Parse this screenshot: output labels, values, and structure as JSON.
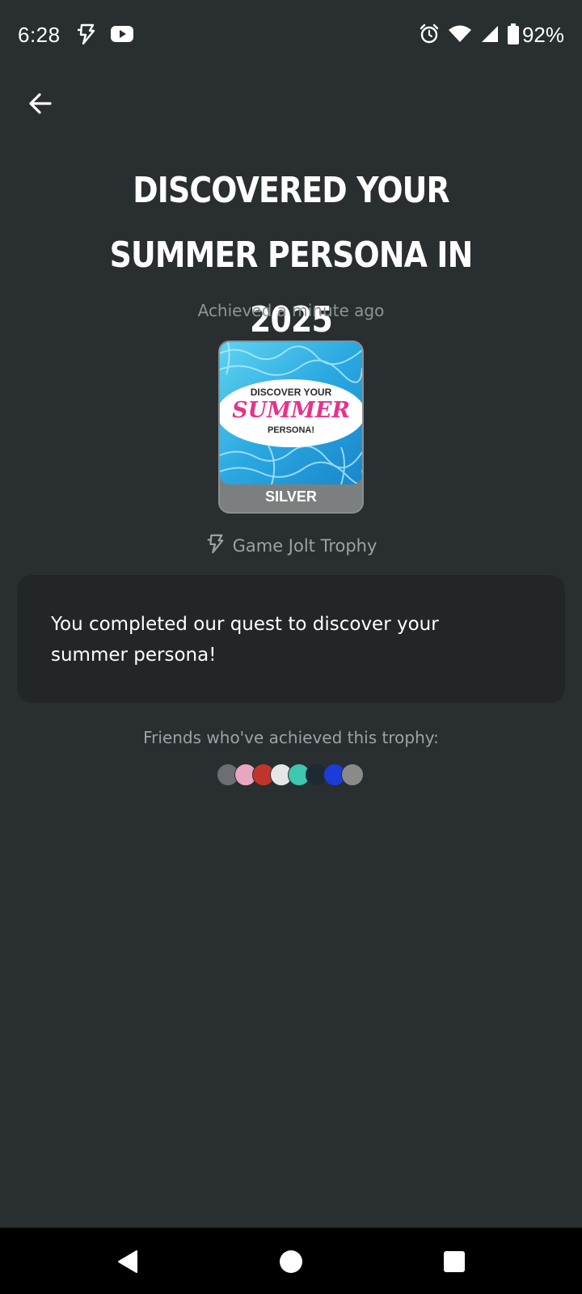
{
  "status_bar": {
    "time": "6:28",
    "battery_percent": "92%",
    "left_icons": [
      "game-jolt-icon",
      "youtube-icon"
    ],
    "right_icons": [
      "alarm-icon",
      "wifi-icon",
      "cell-signal-icon",
      "battery-icon"
    ]
  },
  "header": {
    "back_icon": "arrow-left-icon"
  },
  "trophy": {
    "title": "DISCOVERED YOUR SUMMER PERSONA IN 2025",
    "achieved": "Achieved a minute ago",
    "image_text": {
      "line1": "DISCOVER YOUR",
      "line2": "SUMMER",
      "line3": "PERSONA!"
    },
    "tier": "SILVER",
    "source": "Game Jolt Trophy",
    "description": "You completed our quest to discover your summer persona!"
  },
  "friends": {
    "label": "Friends who've achieved this trophy:",
    "avatar_colors": [
      "#6b6f73",
      "#e9a6c0",
      "#c0352b",
      "#e6e6e6",
      "#3dc7b0",
      "#1c2a34",
      "#1a3cd8",
      "#8a8a8a"
    ]
  },
  "colors": {
    "background": "#292e30",
    "card": "#222628",
    "tier_band": "#7c7f80",
    "muted_text": "#8d9497",
    "summer_pink": "#e8328a"
  },
  "nav_bar": {
    "buttons": [
      "back-triangle-icon",
      "home-circle-icon",
      "recents-square-icon"
    ]
  }
}
